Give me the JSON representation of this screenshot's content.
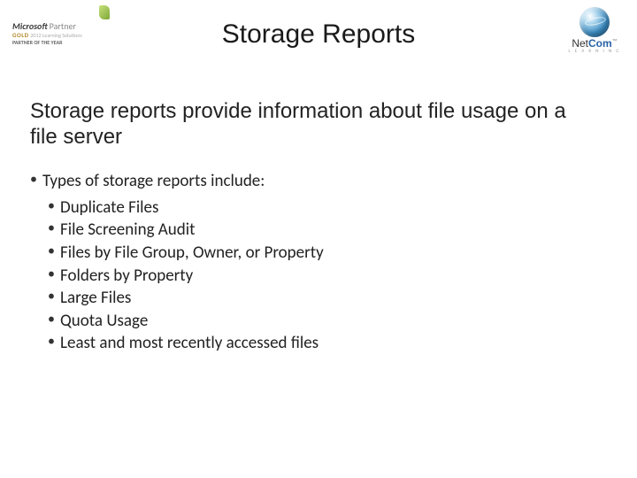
{
  "header": {
    "left_logo": {
      "brand_primary": "Microsoft",
      "brand_secondary": "Partner",
      "tier": "GOLD",
      "subline": "2012 Learning Solutions",
      "award_line": "PARTNER OF THE YEAR"
    },
    "right_logo": {
      "brand_half_a": "Net",
      "brand_half_b": "Com",
      "tagline": "L E A R N I N G"
    }
  },
  "title": "Storage Reports",
  "lead": "Storage reports provide information about file usage on a file server",
  "bullets": {
    "intro": "Types of storage reports include:",
    "items": [
      "Duplicate Files",
      "File Screening Audit",
      "Files by File Group, Owner, or Property",
      "Folders by Property",
      "Large Files",
      "Quota Usage",
      "Least and most recently accessed files"
    ]
  }
}
